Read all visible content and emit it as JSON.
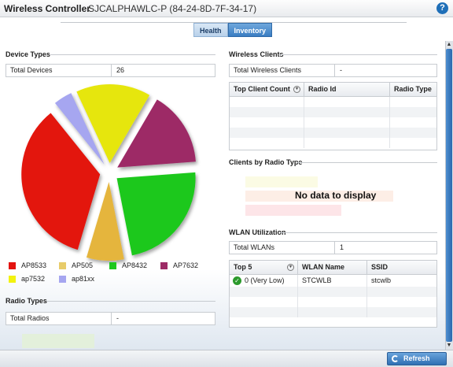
{
  "header": {
    "title": "Wireless Controller",
    "device": "SJCALPHAWLC-P (84-24-8D-7F-34-17)",
    "help_glyph": "?"
  },
  "tabs": [
    {
      "label": "Health",
      "active": false
    },
    {
      "label": "Inventory",
      "active": true
    }
  ],
  "device_types": {
    "title": "Device Types",
    "total_label": "Total Devices",
    "total_value": "26",
    "chart_data": {
      "type": "pie",
      "series": [
        {
          "name": "AP8533",
          "color": "#e3130f",
          "value": 9
        },
        {
          "name": "AP505",
          "color": "#e5b53d",
          "value": 2
        },
        {
          "name": "AP8432",
          "color": "#1ec81e",
          "value": 6
        },
        {
          "name": "AP7632",
          "color": "#9d2b66",
          "value": 4
        },
        {
          "name": "ap7532",
          "color": "#e6e60e",
          "value": 4
        },
        {
          "name": "ap81xx",
          "color": "#a6a6f0",
          "value": 1
        }
      ],
      "legend_placement": "bottom"
    }
  },
  "radio_types": {
    "title": "Radio Types",
    "total_label": "Total Radios",
    "total_value": "-"
  },
  "wireless_clients": {
    "title": "Wireless Clients",
    "total_label": "Total Wireless Clients",
    "total_value": "-",
    "columns": [
      "Top Client Count",
      "Radio Id",
      "Radio Type"
    ]
  },
  "clients_by_radio": {
    "title": "Clients by Radio Type",
    "no_data": "No data to display"
  },
  "wlan_utilization": {
    "title": "WLAN Utilization",
    "total_label": "Total WLANs",
    "total_value": "1",
    "columns": [
      "Top 5",
      "WLAN Name",
      "SSID"
    ],
    "rows": [
      {
        "top5": "0 (Very Low)",
        "wlan_name": "STCWLB",
        "ssid": "stcwlb"
      }
    ]
  },
  "footer": {
    "refresh_label": "Refresh"
  },
  "scrollbar": {
    "up": "▲",
    "down": "▼"
  }
}
